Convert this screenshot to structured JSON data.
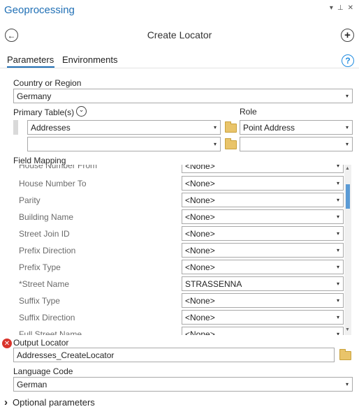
{
  "pane": {
    "title": "Geoprocessing",
    "controls": [
      "▾",
      "⊥",
      "✕"
    ]
  },
  "tool": {
    "title": "Create Locator"
  },
  "tabs": {
    "parameters": "Parameters",
    "environments": "Environments"
  },
  "help_text": "?",
  "country": {
    "label": "Country or Region",
    "value": "Germany"
  },
  "primary_tables": {
    "label": "Primary Table(s)",
    "role_label": "Role",
    "rows": [
      {
        "table": "Addresses",
        "role": "Point Address"
      },
      {
        "table": "",
        "role": ""
      }
    ]
  },
  "field_mapping": {
    "label": "Field Mapping",
    "rows": [
      {
        "name": "House Number From",
        "value": "<None>"
      },
      {
        "name": "House Number To",
        "value": "<None>"
      },
      {
        "name": "Parity",
        "value": "<None>"
      },
      {
        "name": "Building Name",
        "value": "<None>"
      },
      {
        "name": "Street Join ID",
        "value": "<None>"
      },
      {
        "name": "Prefix Direction",
        "value": "<None>"
      },
      {
        "name": "Prefix Type",
        "value": "<None>"
      },
      {
        "name": "*Street Name",
        "value": "STRASSENNA"
      },
      {
        "name": "Suffix Type",
        "value": "<None>"
      },
      {
        "name": "Suffix Direction",
        "value": "<None>"
      },
      {
        "name": "Full Street Name",
        "value": "<None>"
      }
    ]
  },
  "output_locator": {
    "label": "Output Locator",
    "value": "Addresses_CreateLocator"
  },
  "language": {
    "label": "Language Code",
    "value": "German"
  },
  "optional": {
    "label": "Optional parameters"
  },
  "glyphs": {
    "arrow": "▾",
    "error": "✕",
    "chevron_right": "›",
    "chevron_down": "⌄",
    "back": "←",
    "add": "+"
  }
}
